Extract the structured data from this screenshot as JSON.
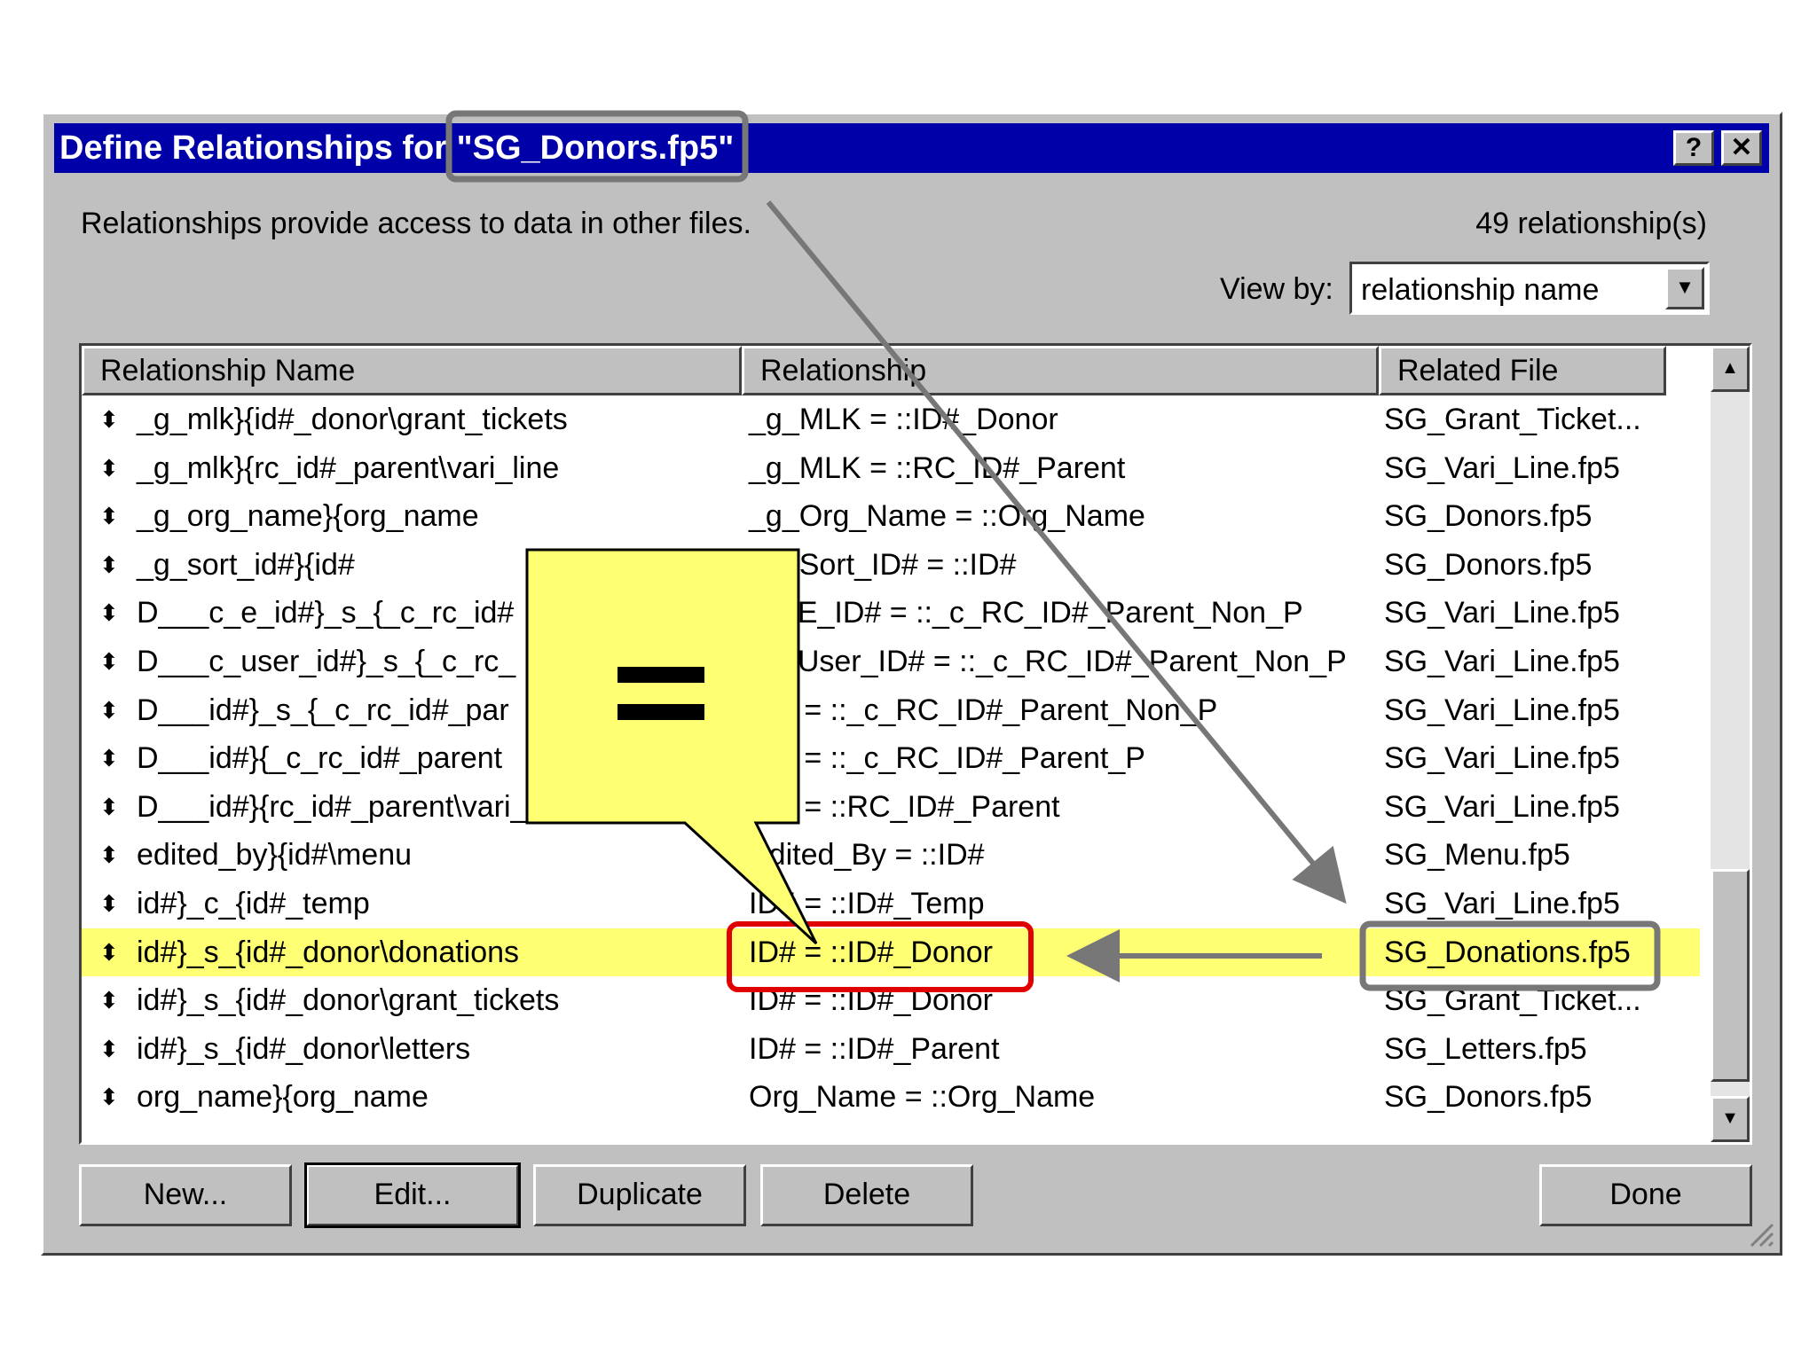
{
  "dialog": {
    "title_prefix": "Define Relationships for ",
    "title_file": "\"SG_Donors.fp5\"",
    "help_label": "?",
    "close_label": "✕",
    "intro_text": "Relationships provide access to data in other files.",
    "count_text": "49 relationship(s)",
    "viewby_label": "View by:",
    "viewby_value": "relationship name"
  },
  "table": {
    "headers": [
      "Relationship Name",
      "Relationship",
      "Related File"
    ],
    "rows": [
      {
        "name": "_g_mlk}{id#_donor\\grant_tickets",
        "rel": "_g_MLK = ::ID#_Donor",
        "file": "SG_Grant_Ticket..."
      },
      {
        "name": "_g_mlk}{rc_id#_parent\\vari_line",
        "rel": "_g_MLK = ::RC_ID#_Parent",
        "file": "SG_Vari_Line.fp5"
      },
      {
        "name": "_g_org_name}{org_name",
        "rel": "_g_Org_Name = ::Org_Name",
        "file": "SG_Donors.fp5"
      },
      {
        "name": "_g_sort_id#}{id#",
        "rel": "_g_Sort_ID# = ::ID#",
        "file": "SG_Donors.fp5"
      },
      {
        "name": "D___c_e_id#}_s_{_c_rc_id#",
        "rel": "_c_E_ID# = ::_c_RC_ID#_Parent_Non_P",
        "file": "SG_Vari_Line.fp5"
      },
      {
        "name": "D___c_user_id#}_s_{_c_rc_",
        "rel": "_c_User_ID# = ::_c_RC_ID#_Parent_Non_P",
        "file": "SG_Vari_Line.fp5"
      },
      {
        "name": "D___id#}_s_{_c_rc_id#_par",
        "rel": "ID# = ::_c_RC_ID#_Parent_Non_P",
        "file": "SG_Vari_Line.fp5"
      },
      {
        "name": "D___id#}{_c_rc_id#_parent",
        "rel": "ID# = ::_c_RC_ID#_Parent_P",
        "file": "SG_Vari_Line.fp5"
      },
      {
        "name": "D___id#}{rc_id#_parent\\vari_line",
        "rel": "ID# = ::RC_ID#_Parent",
        "file": "SG_Vari_Line.fp5"
      },
      {
        "name": "edited_by}{id#\\menu",
        "rel": "Edited_By = ::ID#",
        "file": "SG_Menu.fp5"
      },
      {
        "name": "id#}_c_{id#_temp",
        "rel": "ID# = ::ID#_Temp",
        "file": "SG_Vari_Line.fp5"
      },
      {
        "name": "id#}_s_{id#_donor\\donations",
        "rel": "ID# = ::ID#_Donor",
        "file": "SG_Donations.fp5"
      },
      {
        "name": "id#}_s_{id#_donor\\grant_tickets",
        "rel": "ID# = ::ID#_Donor",
        "file": "SG_Grant_Ticket..."
      },
      {
        "name": "id#}_s_{id#_donor\\letters",
        "rel": "ID# = ::ID#_Parent",
        "file": "SG_Letters.fp5"
      },
      {
        "name": "org_name}{org_name",
        "rel": "Org_Name = ::Org_Name",
        "file": "SG_Donors.fp5"
      }
    ],
    "selected_index": 11,
    "grip_glyph": "⬍"
  },
  "buttons": {
    "new": "New...",
    "edit": "Edit...",
    "duplicate": "Duplicate",
    "delete": "Delete",
    "done": "Done"
  },
  "callout": {
    "text": "="
  },
  "colors": {
    "title_bar": "#0000a8",
    "dialog_bg": "#c0c0c0",
    "highlight": "#ffff73",
    "callout_fill": "#ffff73",
    "red_box": "#e00000",
    "gray_box": "#777777"
  }
}
